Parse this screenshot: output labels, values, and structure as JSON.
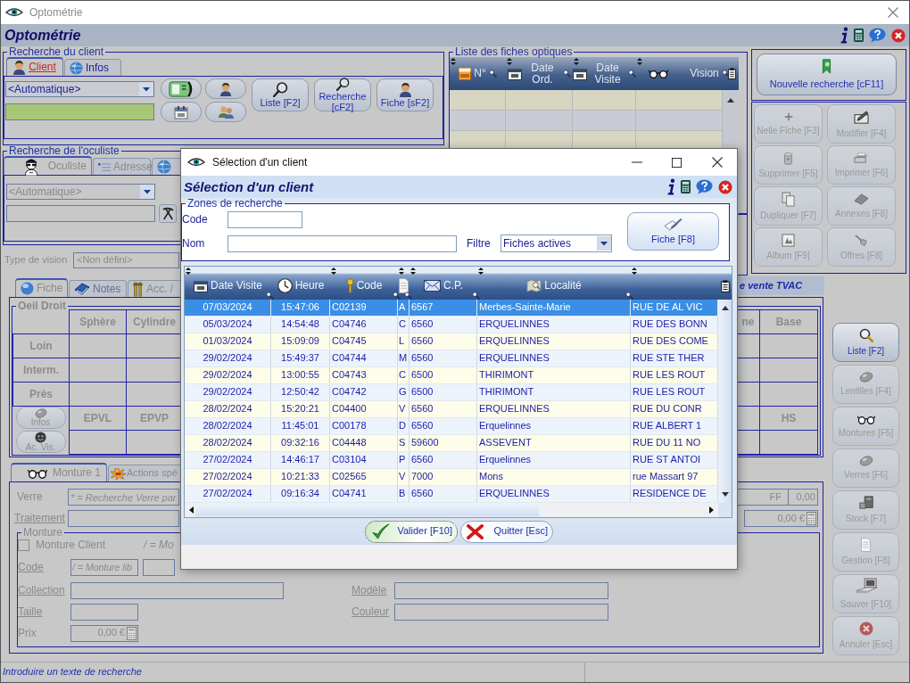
{
  "window": {
    "title": "Optométrie"
  },
  "header": {
    "title": "Optométrie"
  },
  "client_search": {
    "legend": "Recherche du client",
    "tabs": [
      {
        "label": "Client",
        "selected": true
      },
      {
        "label": "Infos",
        "selected": false
      }
    ],
    "mode": "<Automatique>",
    "buttons": [
      "Liste [F2]",
      "Recherche [cF2]",
      "Fiche [sF2]"
    ]
  },
  "oculist_search": {
    "legend": "Recherche de l'oculiste",
    "disabled": true,
    "tabs": [
      {
        "label": "Oculiste",
        "selected": true
      },
      {
        "label": "Adresse",
        "selected": false
      },
      {
        "selected": false
      }
    ],
    "mode": "<Automatique>"
  },
  "vision_type": {
    "label": "Type de vision",
    "value": "<Non défini>"
  },
  "fiches_list": {
    "legend": "Liste des fiches optiques",
    "columns": [
      {
        "kind": "text",
        "label": "N°"
      },
      {
        "kind": "text",
        "label": "Date Ord."
      },
      {
        "kind": "text",
        "label": "Date Visite"
      },
      {
        "kind": "icon"
      },
      {
        "kind": "text",
        "label": "Vision"
      }
    ]
  },
  "actions": {
    "new_search": "Nouvelle recherche [cF11]",
    "buttons": [
      {
        "label": "Nelle Fiche [F3]",
        "disabled": true
      },
      {
        "label": "Modifier [F4]",
        "disabled": true
      },
      {
        "label": "Supprimer [F5]",
        "disabled": true
      },
      {
        "label": "Imprimer [F6]",
        "disabled": true
      },
      {
        "label": "Dupliquer [F7]",
        "disabled": true
      },
      {
        "label": "Annexes [F8]",
        "disabled": true
      },
      {
        "label": "Album [F9]",
        "disabled": true
      },
      {
        "label": "Offres [F8]",
        "disabled": true
      }
    ]
  },
  "price_strip": {
    "label": "e vente TVAC"
  },
  "fiche_tabs": [
    {
      "label": "Fiche",
      "selected": true
    },
    {
      "label": "Notes",
      "selected": false
    },
    {
      "label": "Acc. /",
      "selected": false
    }
  ],
  "oeil_droit": {
    "legend": "Oeil Droit",
    "columns": [
      "Sphère",
      "Cylindre",
      "ne",
      "Base"
    ],
    "rows": [
      "Loin",
      "Interm.",
      "Près"
    ],
    "measures": [
      "EPVL",
      "EPVP",
      "HS"
    ],
    "buttons": [
      {
        "label": "Infos",
        "disabled": true
      },
      {
        "label": "Ac. Vis.",
        "disabled": true
      }
    ]
  },
  "monture_tabs": [
    {
      "label": "Monture 1",
      "selected": true
    },
    {
      "label": "Actions spé",
      "selected": false
    }
  ],
  "verre": {
    "label": "Verre",
    "placeholder": "* = Recherche Verre par",
    "unit": "FF",
    "amount": "0,00"
  },
  "traitement": {
    "label": "Traitement",
    "price": "0,00 €"
  },
  "monture": {
    "legend": "Monture",
    "client": {
      "label": "Monture Client",
      "checked": false
    },
    "hint": "/ = Mo",
    "code": {
      "label": "Code",
      "placeholder": "/ = Monture lib"
    },
    "collection": {
      "label": "Collection"
    },
    "modele": {
      "label": "Modèle"
    },
    "taille": {
      "label": "Taille"
    },
    "couleur": {
      "label": "Couleur"
    },
    "prix": {
      "label": "Prix",
      "value": "0,00 €"
    }
  },
  "side_buttons": [
    {
      "label": "Liste [F2]",
      "disabled": false
    },
    {
      "label": "Lentilles [F4]",
      "disabled": true
    },
    {
      "label": "Montures [F5]",
      "disabled": true
    },
    {
      "label": "Verres [F6]",
      "disabled": true
    },
    {
      "label": "Stock [F7]",
      "disabled": true
    },
    {
      "label": "Gestion [F8]",
      "disabled": true
    },
    {
      "label": "Sauver [F10]",
      "disabled": true
    },
    {
      "label": "Annuler [Esc]",
      "disabled": true
    }
  ],
  "status_bar": {
    "text": "Introduire un texte de recherche"
  },
  "dialog": {
    "title": "Sélection d'un client",
    "header": "Sélection d'un client",
    "search": {
      "legend": "Zones de recherche",
      "code_label": "Code",
      "name_label": "Nom",
      "filter_label": "Filtre",
      "filter_value": "Fiches actives",
      "button": "Fiche [F8]"
    },
    "table": {
      "columns": [
        {
          "kind": "text",
          "label": "Date Visite"
        },
        {
          "kind": "text",
          "label": "Heure"
        },
        {
          "kind": "text",
          "label": "Code"
        },
        {
          "kind": "icon"
        },
        {
          "kind": "text",
          "label": "C.P."
        },
        {
          "kind": "text",
          "label": "Localité"
        },
        {
          "kind": "blank"
        }
      ],
      "rows": [
        {
          "selected": true,
          "cells": [
            "07/03/2024",
            "15:47:06",
            "C02139",
            "A",
            "6567",
            "Merbes-Sainte-Marie",
            "RUE DE AL VIC"
          ]
        },
        {
          "selected": false,
          "cells": [
            "05/03/2024",
            "14:54:48",
            "C04746",
            "C",
            "6560",
            "ERQUELINNES",
            "RUE DES BONN"
          ]
        },
        {
          "selected": false,
          "cells": [
            "01/03/2024",
            "15:09:09",
            "C04745",
            "L",
            "6560",
            "ERQUELINNES",
            "RUE DES COME"
          ]
        },
        {
          "selected": false,
          "cells": [
            "29/02/2024",
            "15:49:37",
            "C04744",
            "M",
            "6560",
            "ERQUELINNES",
            "RUE STE THER"
          ]
        },
        {
          "selected": false,
          "cells": [
            "29/02/2024",
            "13:00:55",
            "C04743",
            "C",
            "6500",
            "THIRIMONT",
            "RUE LES ROUT"
          ]
        },
        {
          "selected": false,
          "cells": [
            "29/02/2024",
            "12:50:42",
            "C04742",
            "G",
            "6500",
            "THIRIMONT",
            "RUE LES ROUT"
          ]
        },
        {
          "selected": false,
          "cells": [
            "28/02/2024",
            "15:20:21",
            "C04400",
            "V",
            "6560",
            "ERQUELINNES",
            "RUE DU CONR"
          ]
        },
        {
          "selected": false,
          "cells": [
            "28/02/2024",
            "11:45:01",
            "C00178",
            "D",
            "6560",
            "Erquelinnes",
            "RUE ALBERT 1"
          ]
        },
        {
          "selected": false,
          "cells": [
            "28/02/2024",
            "09:32:16",
            "C04448",
            "S",
            "59600",
            "ASSEVENT",
            "RUE DU 11 NO"
          ]
        },
        {
          "selected": false,
          "cells": [
            "27/02/2024",
            "14:46:17",
            "C03104",
            "P",
            "6560",
            "Erquelinnes",
            "RUE ST ANTOI"
          ]
        },
        {
          "selected": false,
          "cells": [
            "27/02/2024",
            "10:21:33",
            "C02565",
            "V",
            "7000",
            "Mons",
            "rue Massart 97"
          ]
        },
        {
          "selected": false,
          "cells": [
            "27/02/2024",
            "09:16:34",
            "C04741",
            "B",
            "6560",
            "ERQUELINNES",
            "RESIDENCE DE"
          ]
        }
      ]
    },
    "buttons": [
      {
        "kind": "confirm",
        "label": "Valider [F10]"
      },
      {
        "kind": "cancel",
        "label": "Quitter [Esc]"
      }
    ]
  }
}
